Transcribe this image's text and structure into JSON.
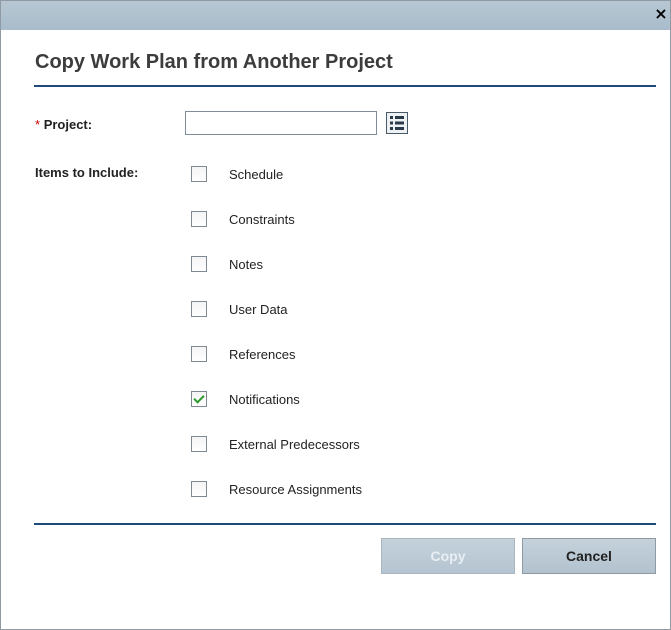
{
  "dialog": {
    "close_label": "×",
    "title": "Copy Work Plan from Another Project"
  },
  "form": {
    "project": {
      "required_marker": "*",
      "label": "Project:",
      "value": ""
    },
    "items_label": "Items to Include:",
    "items": [
      {
        "label": "Schedule",
        "checked": false
      },
      {
        "label": "Constraints",
        "checked": false
      },
      {
        "label": "Notes",
        "checked": false
      },
      {
        "label": "User Data",
        "checked": false
      },
      {
        "label": "References",
        "checked": false
      },
      {
        "label": "Notifications",
        "checked": true
      },
      {
        "label": "External Predecessors",
        "checked": false
      },
      {
        "label": "Resource Assignments",
        "checked": false
      }
    ]
  },
  "buttons": {
    "copy_label": "Copy",
    "copy_enabled": false,
    "cancel_label": "Cancel"
  },
  "icons": {
    "picker": "list-picker-icon",
    "close": "close-icon"
  }
}
